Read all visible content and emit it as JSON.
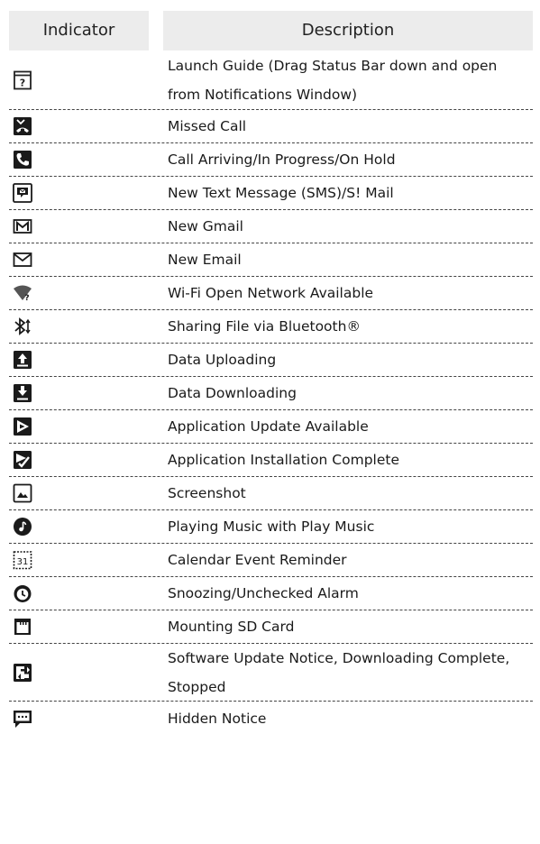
{
  "header": {
    "indicator_label": "Indicator",
    "description_label": "Description"
  },
  "rows": [
    {
      "icon": "launch-guide-icon",
      "description": "Launch Guide (Drag Status Bar down and open from Notifications Window)"
    },
    {
      "icon": "missed-call-icon",
      "description": "Missed Call"
    },
    {
      "icon": "call-in-progress-icon",
      "description": "Call Arriving/In Progress/On Hold"
    },
    {
      "icon": "text-message-icon",
      "description": "New Text Message (SMS)/S! Mail"
    },
    {
      "icon": "gmail-icon",
      "description": "New Gmail"
    },
    {
      "icon": "email-icon",
      "description": "New Email"
    },
    {
      "icon": "wifi-open-network-icon",
      "description": "Wi-Fi Open Network Available"
    },
    {
      "icon": "bluetooth-sharing-icon",
      "description": "Sharing File via Bluetooth®"
    },
    {
      "icon": "upload-icon",
      "description": "Data Uploading"
    },
    {
      "icon": "download-icon",
      "description": "Data Downloading"
    },
    {
      "icon": "app-update-icon",
      "description": "Application Update Available"
    },
    {
      "icon": "install-complete-icon",
      "description": "Application Installation Complete"
    },
    {
      "icon": "screenshot-icon",
      "description": "Screenshot"
    },
    {
      "icon": "play-music-icon",
      "description": "Playing Music with Play Music"
    },
    {
      "icon": "calendar-icon",
      "description": "Calendar Event Reminder"
    },
    {
      "icon": "alarm-icon",
      "description": "Snoozing/Unchecked Alarm"
    },
    {
      "icon": "sd-card-icon",
      "description": "Mounting SD Card"
    },
    {
      "icon": "software-update-icon",
      "description": "Software Update Notice, Downloading Complete, Stopped"
    },
    {
      "icon": "hidden-notice-icon",
      "description": "Hidden Notice"
    }
  ],
  "calendar_icon_text": "31"
}
